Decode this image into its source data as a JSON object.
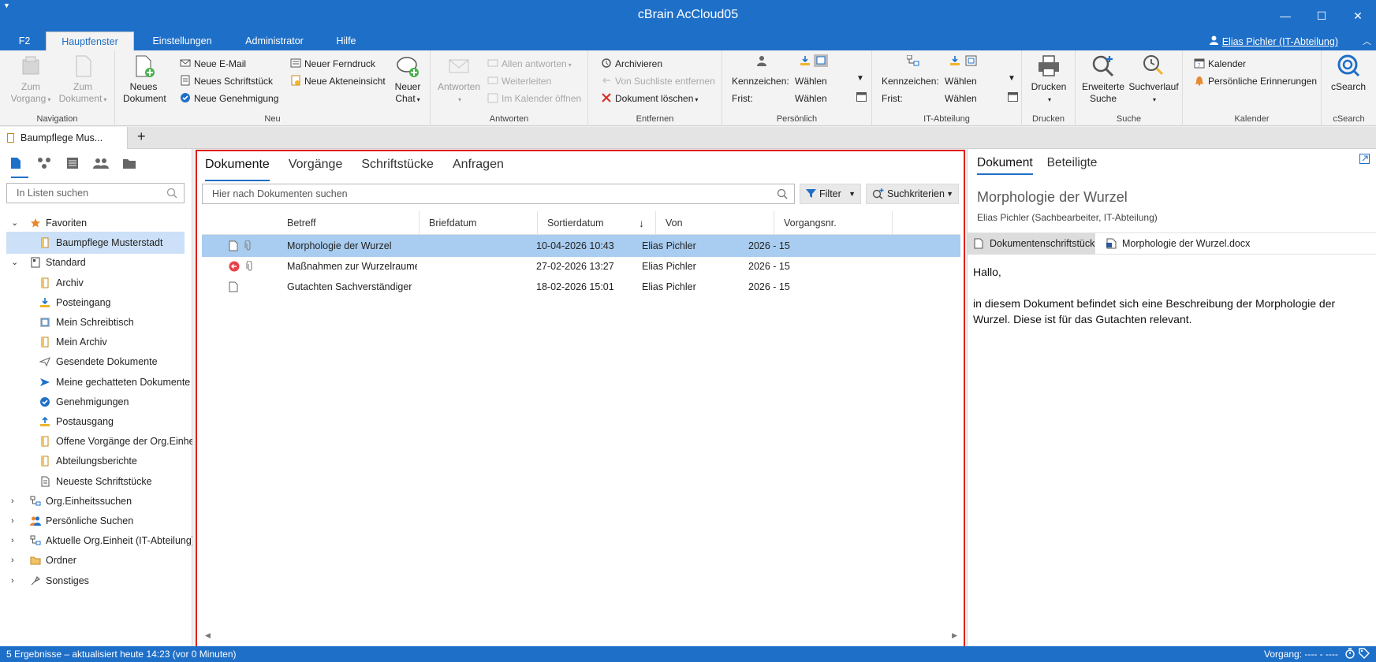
{
  "window": {
    "title": "cBrain AcCloud05",
    "minimize": "—",
    "maximize": "☐",
    "close": "✕"
  },
  "ribbon_tabs": [
    "F2",
    "Hauptfenster",
    "Einstellungen",
    "Administrator",
    "Hilfe"
  ],
  "user": "Elias Pichler (IT-Abteilung)",
  "ribbon": {
    "navigation": {
      "label": "Navigation",
      "zum_vorgang": [
        "Zum",
        "Vorgang"
      ],
      "zum_dokument": [
        "Zum",
        "Dokument"
      ]
    },
    "neu": {
      "label": "Neu",
      "neues_dokument": [
        "Neues",
        "Dokument"
      ],
      "neue_email": "Neue E-Mail",
      "neues_schriftstueck": "Neues Schriftstück",
      "neue_genehmigung": "Neue Genehmigung",
      "neuer_ferndruck": "Neuer Ferndruck",
      "neue_akteneinsicht": "Neue Akteneinsicht",
      "neuer_chat": [
        "Neuer",
        "Chat"
      ]
    },
    "antworten": {
      "label": "Antworten",
      "antworten_btn": "Antworten",
      "allen_antworten": "Allen antworten",
      "weiterleiten": "Weiterleiten",
      "im_kalender": "Im Kalender öffnen"
    },
    "entfernen": {
      "label": "Entfernen",
      "archivieren": "Archivieren",
      "von_suchliste": "Von Suchliste entfernen",
      "dokument_loeschen": "Dokument löschen"
    },
    "persoenlich": {
      "label": "Persönlich",
      "kennzeichen": "Kennzeichen:",
      "frist": "Frist:",
      "waehlen1": "Wählen",
      "waehlen2": "Wählen"
    },
    "it": {
      "label": "IT-Abteilung",
      "kennzeichen": "Kennzeichen:",
      "frist": "Frist:",
      "waehlen1": "Wählen",
      "waehlen2": "Wählen"
    },
    "drucken": {
      "label": "Drucken",
      "btn": "Drucken"
    },
    "suche": {
      "label": "Suche",
      "erweiterte": [
        "Erweiterte",
        "Suche"
      ],
      "suchverlauf": "Suchverlauf"
    },
    "kalender": {
      "label": "Kalender",
      "kalender_btn": "Kalender",
      "erinnerungen": "Persönliche Erinnerungen"
    },
    "csearch": {
      "label": "cSearch",
      "btn": "cSearch"
    }
  },
  "doc_tab": {
    "label": "Baumpflege Mus...",
    "close": "✕",
    "new": "+"
  },
  "left": {
    "search_placeholder": "In Listen suchen",
    "tree": [
      {
        "label": "Favoriten",
        "level": 0,
        "chev": "⌄",
        "icon": "star-icon"
      },
      {
        "label": "Baumpflege Musterstadt",
        "level": 1,
        "icon": "folder-doc-icon",
        "selected": true
      },
      {
        "label": "Standard",
        "level": 0,
        "chev": "⌄",
        "icon": "square-doc-icon"
      },
      {
        "label": "Archiv",
        "level": 1,
        "icon": "folder-doc-icon"
      },
      {
        "label": "Posteingang",
        "level": 1,
        "icon": "inbox-icon"
      },
      {
        "label": "Mein Schreibtisch",
        "level": 1,
        "icon": "desk-icon"
      },
      {
        "label": "Mein Archiv",
        "level": 1,
        "icon": "folder-doc-icon"
      },
      {
        "label": "Gesendete Dokumente",
        "level": 1,
        "icon": "sent-icon"
      },
      {
        "label": "Meine gechatteten Dokumente",
        "level": 1,
        "icon": "send-arrow-icon"
      },
      {
        "label": "Genehmigungen",
        "level": 1,
        "icon": "check-circle-icon"
      },
      {
        "label": "Postausgang",
        "level": 1,
        "icon": "outbox-icon"
      },
      {
        "label": "Offene Vorgänge der Org.Einheit",
        "level": 1,
        "icon": "folder-doc-icon"
      },
      {
        "label": "Abteilungsberichte",
        "level": 1,
        "icon": "folder-doc-icon"
      },
      {
        "label": "Neueste Schriftstücke",
        "level": 1,
        "icon": "doc-lines-icon"
      },
      {
        "label": "Org.Einheitssuchen",
        "level": 0,
        "chev": "›",
        "icon": "org-icon"
      },
      {
        "label": "Persönliche Suchen",
        "level": 0,
        "chev": "›",
        "icon": "people-icon"
      },
      {
        "label": "Aktuelle Org.Einheit (IT-Abteilung)",
        "level": 0,
        "chev": "›",
        "icon": "org-icon"
      },
      {
        "label": "Ordner",
        "level": 0,
        "chev": "›",
        "icon": "folder-icon"
      },
      {
        "label": "Sonstiges",
        "level": 0,
        "chev": "›",
        "icon": "misc-icon"
      }
    ]
  },
  "center": {
    "tabs": [
      "Dokumente",
      "Vorgänge",
      "Schriftstücke",
      "Anfragen"
    ],
    "search_placeholder": "Hier nach Dokumenten suchen",
    "filter": "Filter",
    "suchkriterien": "Suchkriterien",
    "columns": [
      "Betreff",
      "Briefdatum",
      "Sortierdatum",
      "Von",
      "Vorgangsnr."
    ],
    "rows": [
      {
        "betreff": "Morphologie der Wurzel",
        "briefdatum": "",
        "sortierdatum": "10-04-2026 10:43",
        "von": "Elias Pichler",
        "vorgangsnr": "2026 - 15",
        "selected": true,
        "icons": [
          "doc",
          "clip"
        ]
      },
      {
        "betreff": "Maßnahmen zur Wurzelraumerweiterung",
        "briefdatum": "",
        "sortierdatum": "27-02-2026 13:27",
        "von": "Elias Pichler",
        "vorgangsnr": "2026 - 15",
        "icons": [
          "back",
          "clip"
        ]
      },
      {
        "betreff": "Gutachten Sachverständiger",
        "briefdatum": "",
        "sortierdatum": "18-02-2026 15:01",
        "von": "Elias Pichler",
        "vorgangsnr": "2026 - 15",
        "icons": [
          "doc"
        ]
      }
    ]
  },
  "right": {
    "tabs": [
      "Dokument",
      "Beteiligte"
    ],
    "title": "Morphologie der Wurzel",
    "subtitle": "Elias Pichler (Sachbearbeiter, IT-Abteilung)",
    "doc_tabs": [
      "Dokumentenschriftstück",
      "Morphologie der Wurzel.docx"
    ],
    "body": [
      "Hallo,",
      "in diesem Dokument befindet sich eine Beschreibung der Morphologie der Wurzel. Diese ist für das Gutachten relevant."
    ]
  },
  "status": {
    "left": "5 Ergebnisse – aktualisiert heute 14:23 (vor 0 Minuten)",
    "right": "Vorgang: ---- - ----"
  }
}
